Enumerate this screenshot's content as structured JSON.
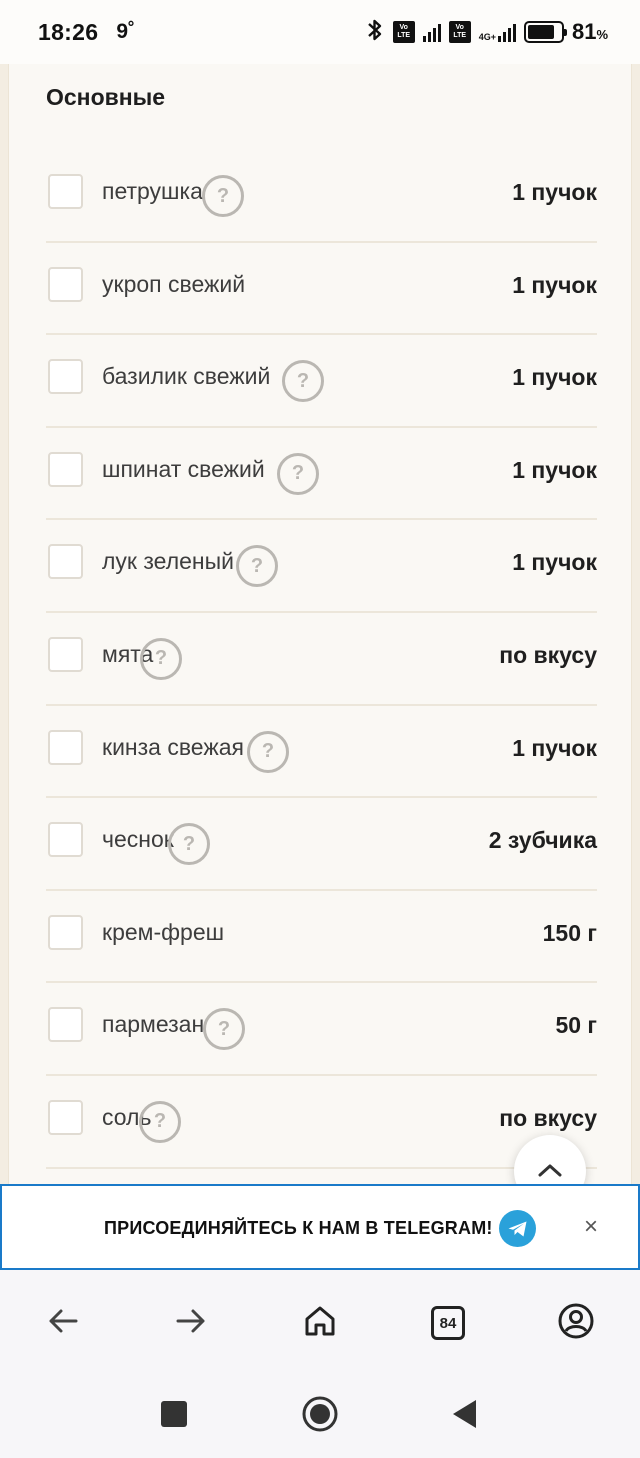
{
  "status_bar": {
    "time": "18:26",
    "temperature": "9˚",
    "battery_percent": "81",
    "battery_unit": "%",
    "network_label": "4G+",
    "volte_label_top": "Vo",
    "volte_label_bottom": "LTE"
  },
  "section": {
    "title": "Основные"
  },
  "ingredients": [
    {
      "name": "петрушка",
      "quantity": "1 пучок",
      "has_help": true
    },
    {
      "name": "укроп свежий",
      "quantity": "1 пучок",
      "has_help": false
    },
    {
      "name": "базилик свежий",
      "quantity": "1 пучок",
      "has_help": true
    },
    {
      "name": "шпинат свежий",
      "quantity": "1 пучок",
      "has_help": true
    },
    {
      "name": "лук зеленый",
      "quantity": "1 пучок",
      "has_help": true
    },
    {
      "name": "мята",
      "quantity": "по вкусу",
      "has_help": true
    },
    {
      "name": "кинза свежая",
      "quantity": "1 пучок",
      "has_help": true
    },
    {
      "name": "чеснок",
      "quantity": "2 зубчика",
      "has_help": true
    },
    {
      "name": "крем-фреш",
      "quantity": "150 г",
      "has_help": false
    },
    {
      "name": "пармезан",
      "quantity": "50 г",
      "has_help": true
    },
    {
      "name": "соль",
      "quantity": "по вкусу",
      "has_help": true
    }
  ],
  "help_icon_symbol": "?",
  "banner": {
    "text": "ПРИСОЕДИНЯЙТЕСЬ К НАМ В TELEGRAM!",
    "close_symbol": "×"
  },
  "browser_nav": {
    "tabs_count": "84"
  },
  "icons": {
    "scroll_top": "chevron-up-icon",
    "back": "arrow-left-icon",
    "forward": "arrow-right-icon",
    "home": "home-icon",
    "account": "account-circle-icon",
    "telegram": "telegram-icon",
    "bluetooth": "bluetooth-icon"
  },
  "colors": {
    "accent_blue": "#1a7ac9",
    "telegram_blue": "#2aa1da",
    "card_bg": "#faf8f4",
    "page_bg": "#f3ede2"
  }
}
